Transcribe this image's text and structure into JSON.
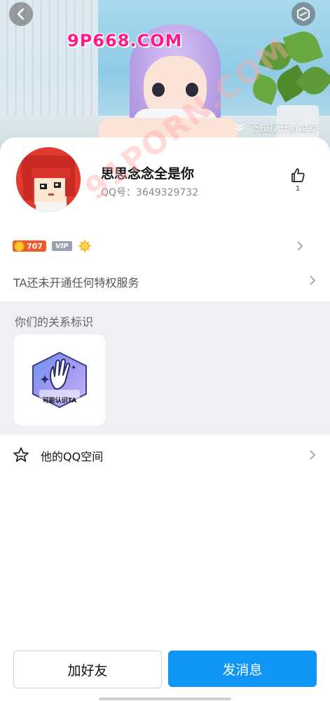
{
  "header": {
    "watermark": "9P668.COM",
    "pull_hint": "下拉打开新世界",
    "back_icon": "chevron-left-icon",
    "theme_icon": "hexagon-icon"
  },
  "profile": {
    "name": "思思念念全是你",
    "qq_number": "QQ号：3649329732",
    "like_count": "1",
    "avatar": "pixel-avatar"
  },
  "diagonal_watermark": "91PORN.COM",
  "badges": {
    "coin_value": "707",
    "vip_label": "VIP",
    "sun_icon": "sun-badge-icon"
  },
  "privilege": {
    "text": "TA还未开通任何特权服务"
  },
  "relation": {
    "title": "你们的关系标识",
    "tag_label": "可能认识TA"
  },
  "qzone": {
    "label": "他的QQ空间",
    "icon": "star-icon"
  },
  "actions": {
    "add_friend": "加好友",
    "send_message": "发消息"
  },
  "colors": {
    "primary": "#0f95f3",
    "coin": "#f05a26",
    "section_bg": "#f0f0f4"
  }
}
